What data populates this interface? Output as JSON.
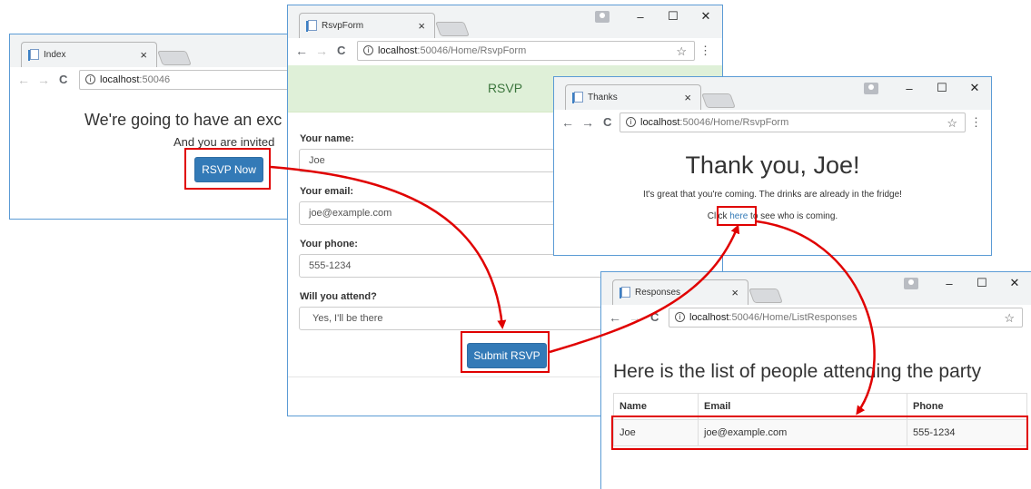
{
  "index_window": {
    "tab_title": "Index",
    "tab_close": "×",
    "url_host": "localhost",
    "url_path": ":50046",
    "heading": "We're going to have an exc",
    "subheading": "And you are invited",
    "rsvp_button": "RSVP Now"
  },
  "rsvp_window": {
    "tab_title": "RsvpForm",
    "tab_close": "×",
    "url_host": "localhost",
    "url_path": ":50046/Home/RsvpForm",
    "header": "RSVP",
    "name_label": "Your name:",
    "name_value": "Joe",
    "email_label": "Your email:",
    "email_value": "joe@example.com",
    "phone_label": "Your phone:",
    "phone_value": "555-1234",
    "attend_label": "Will you attend?",
    "attend_value": "Yes, I'll be there",
    "submit_button": "Submit RSVP",
    "controls": {
      "minimize": "–",
      "maximize": "☐",
      "close": "✕"
    }
  },
  "thanks_window": {
    "tab_title": "Thanks",
    "tab_close": "×",
    "url_host": "localhost",
    "url_path": ":50046/Home/RsvpForm",
    "heading": "Thank you, Joe!",
    "message": "It's great that you're coming. The drinks are already in the fridge!",
    "click_prefix": "Click ",
    "link_text": "here",
    "click_suffix": " to see who is coming.",
    "controls": {
      "minimize": "–",
      "maximize": "☐",
      "close": "✕"
    }
  },
  "responses_window": {
    "tab_title": "Responses",
    "tab_close": "×",
    "url_host": "localhost",
    "url_path": ":50046/Home/ListResponses",
    "heading": "Here is the list of people attending the party",
    "columns": [
      "Name",
      "Email",
      "Phone"
    ],
    "rows": [
      [
        "Joe",
        "joe@example.com",
        "555-1234"
      ]
    ],
    "controls": {
      "minimize": "–",
      "maximize": "☐",
      "close": "✕"
    }
  },
  "browser": {
    "back": "←",
    "forward": "→",
    "reload": "C",
    "info": "i",
    "star": "☆",
    "menu": "⋮"
  },
  "colors": {
    "window_border": "#5b9bd5",
    "primary_button": "#337ab7",
    "highlight": "#e00000",
    "rsvp_header_bg": "#dff0d8",
    "rsvp_header_text": "#3c763d",
    "link": "#337ab7"
  }
}
